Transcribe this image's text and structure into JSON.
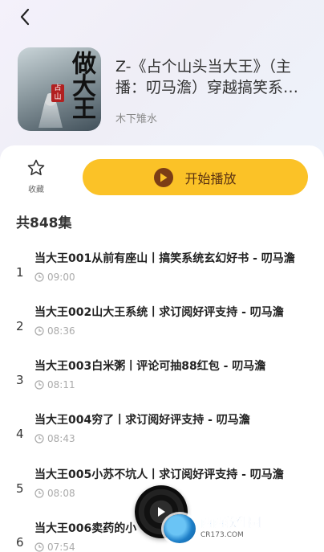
{
  "header": {
    "book_title": "Z-《占个山头当大王》（主播：叨马澹）穿越搞笑系统玄幻",
    "author": "木下雉水",
    "cover_art_text": "做大王",
    "cover_seal_text": "占山"
  },
  "actions": {
    "favorite_label": "收藏",
    "play_label": "开始播放"
  },
  "episode_count_label": "共848集",
  "episodes": [
    {
      "num": "1",
      "title": "当大王001从前有座山丨搞笑系统玄幻好书 - 叨马澹",
      "duration": "09:00"
    },
    {
      "num": "2",
      "title": "当大王002山大王系统丨求订阅好评支持 - 叨马澹",
      "duration": "08:36"
    },
    {
      "num": "3",
      "title": "当大王003白米粥丨评论可抽88红包 - 叨马澹",
      "duration": "08:11"
    },
    {
      "num": "4",
      "title": "当大王004穷了丨求订阅好评支持 - 叨马澹",
      "duration": "08:43"
    },
    {
      "num": "5",
      "title": "当大王005小苏不坑人丨求订阅好评支持 - 叨马澹",
      "duration": "08:08"
    },
    {
      "num": "6",
      "title": "当大王006卖药的小",
      "duration": "07:54"
    }
  ],
  "watermark": {
    "brand_a": "西西",
    "brand_b": "软件园",
    "site": "CR173.COM"
  },
  "icons": {
    "back": "chevron-left-icon",
    "favorite": "star-outline-icon",
    "play": "play-circle-icon",
    "clock": "clock-icon",
    "disc": "vinyl-disc-icon"
  },
  "colors": {
    "accent": "#fbc227",
    "play_icon": "#7b3d16"
  }
}
